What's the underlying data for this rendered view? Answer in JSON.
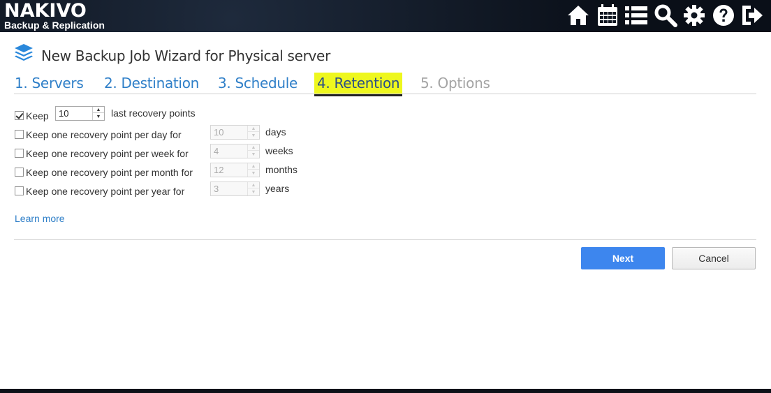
{
  "app": {
    "logo_main": "NAKIVO",
    "logo_sub": "Backup & Replication"
  },
  "topbar": {
    "icons": [
      "home-icon",
      "calendar-icon",
      "list-icon",
      "search-icon",
      "gear-icon",
      "help-icon",
      "logout-icon"
    ]
  },
  "wizard": {
    "title": "New Backup Job Wizard for Physical server",
    "tabs": [
      {
        "label": "1. Servers",
        "state": "link"
      },
      {
        "label": "2. Destination",
        "state": "link"
      },
      {
        "label": "3. Schedule",
        "state": "link"
      },
      {
        "label": "4. Retention",
        "state": "active"
      },
      {
        "label": "5. Options",
        "state": "disabled"
      }
    ]
  },
  "retention": {
    "keep_last": {
      "checked": true,
      "label": "Keep",
      "value": "10",
      "suffix": "last recovery points"
    },
    "per_day": {
      "checked": false,
      "label": "Keep one recovery point per day for",
      "value": "10",
      "suffix": "days"
    },
    "per_week": {
      "checked": false,
      "label": "Keep one recovery point per week for",
      "value": "4",
      "suffix": "weeks"
    },
    "per_month": {
      "checked": false,
      "label": "Keep one recovery point per month for",
      "value": "12",
      "suffix": "months"
    },
    "per_year": {
      "checked": false,
      "label": "Keep one recovery point per year for",
      "value": "3",
      "suffix": "years"
    }
  },
  "learn_more": "Learn more",
  "buttons": {
    "next": "Next",
    "cancel": "Cancel"
  },
  "colors": {
    "accent_blue": "#3d86ee",
    "link_blue": "#2f7fc8",
    "active_tab_highlight": "#eef71e"
  }
}
